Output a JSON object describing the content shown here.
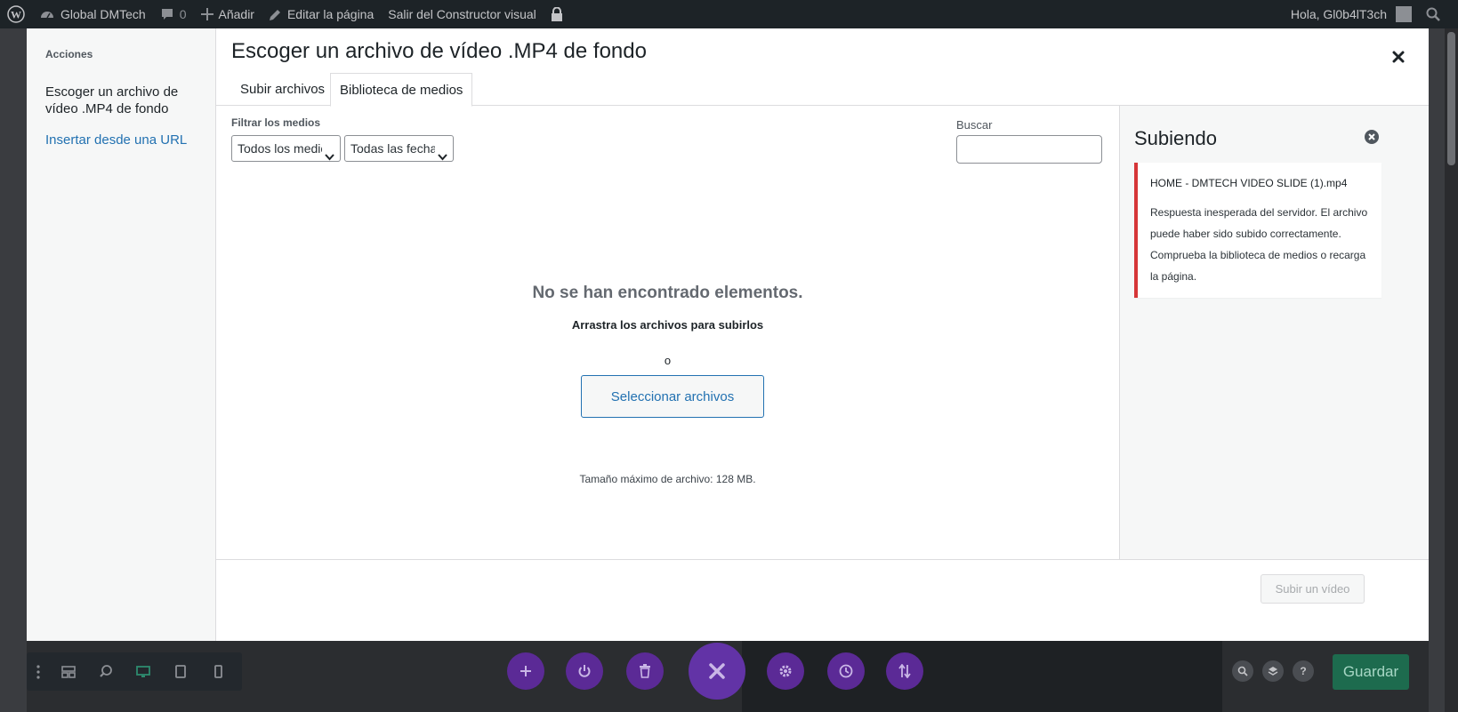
{
  "admin_bar": {
    "site_name": "Global DMTech",
    "comments_count": "0",
    "add_new": "Añadir",
    "edit_page": "Editar la página",
    "exit_builder": "Salir del Constructor visual",
    "greeting": "Hola, Gl0b4lT3ch"
  },
  "modal": {
    "menu_heading": "Acciones",
    "menu_active": "Escoger un archivo de vídeo .MP4 de fondo",
    "menu_link": "Insertar desde una URL",
    "title": "Escoger un archivo de vídeo .MP4 de fondo",
    "tabs": [
      {
        "label": "Subir archivos",
        "active": false
      },
      {
        "label": "Biblioteca de medios",
        "active": true
      }
    ],
    "filter_label": "Filtrar los medios",
    "filter_media_value": "Todos los medios",
    "filter_dates_value": "Todas las fechas",
    "search_label": "Buscar",
    "search_value": "",
    "empty_title": "No se han encontrado elementos.",
    "drop_text": "Arrastra los archivos para subirlos",
    "or_text": "o",
    "select_files": "Seleccionar archivos",
    "max_size": "Tamaño máximo de archivo: 128 MB.",
    "insert_button": "Subir un vídeo"
  },
  "uploading": {
    "title": "Subiendo",
    "file_name": "HOME - DMTECH VIDEO SLIDE (1).mp4",
    "error_message": "Respuesta inesperada del servidor. El archivo puede haber sido subido correctamente. Comprueba la biblioteca de medios o recarga la página."
  },
  "builder_bar": {
    "save_label": "Guardar"
  },
  "colors": {
    "accent": "#2271b1",
    "error": "#d63638",
    "builder_purple": "#5b2a96",
    "save_green": "#1d6b4e"
  }
}
